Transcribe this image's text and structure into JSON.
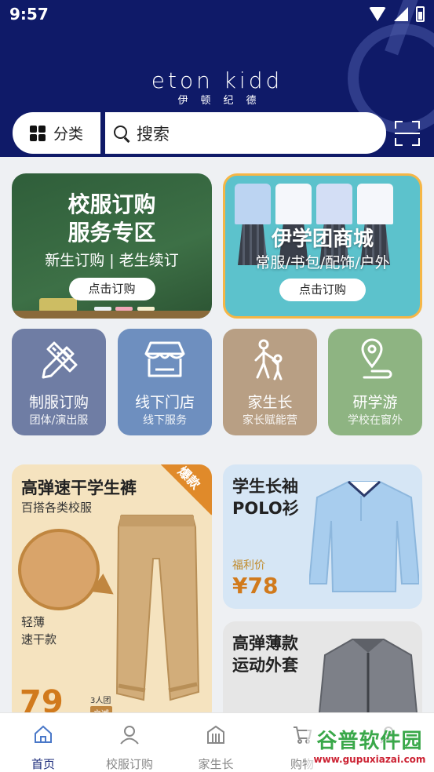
{
  "status": {
    "time": "9:57"
  },
  "brand": {
    "en": "eton kidd",
    "cn": "伊顿纪德"
  },
  "header": {
    "category_label": "分类",
    "search_placeholder": "搜索"
  },
  "banners": [
    {
      "title_line1": "校服订购",
      "title_line2": "服务专区",
      "subtitle": "新生订购 | 老生续订",
      "button": "点击订购"
    },
    {
      "title": "伊学团商城",
      "subtitle": "常服/书包/配饰/户外",
      "button": "点击订购"
    }
  ],
  "tiles": [
    {
      "title": "制服订购",
      "subtitle": "团体/演出服",
      "color": "#6f7da4",
      "icon": "ruler-pencil-icon"
    },
    {
      "title": "线下门店",
      "subtitle": "线下服务",
      "color": "#6e8fbf",
      "icon": "store-icon"
    },
    {
      "title": "家生长",
      "subtitle": "家长赋能营",
      "color": "#b89f84",
      "icon": "family-icon"
    },
    {
      "title": "研学游",
      "subtitle": "学校在窗外",
      "color": "#8eb482",
      "icon": "location-pin-icon"
    }
  ],
  "products": {
    "big": {
      "title": "高弹速干学生裤",
      "subtitle": "百搭各类校服",
      "feature_line1": "轻薄",
      "feature_line2": "速干款",
      "price": "79",
      "badge": "爆款",
      "group_note": "3人团",
      "instant_note": "立减"
    },
    "polo": {
      "title_line1": "学生长袖",
      "title_line2": "POLO衫",
      "sub": "福利价",
      "price": "¥78"
    },
    "jacket": {
      "title_line1": "高弹薄款",
      "title_line2": "运动外套"
    }
  },
  "tabbar": [
    {
      "label": "首页",
      "active": true,
      "icon": "home-icon"
    },
    {
      "label": "校服订购",
      "active": false,
      "icon": "user-icon"
    },
    {
      "label": "家生长",
      "active": false,
      "icon": "building-icon"
    },
    {
      "label": "购物",
      "active": false,
      "icon": "cart-icon"
    },
    {
      "label": "",
      "active": false,
      "icon": "profile-icon"
    }
  ],
  "watermark": {
    "line1": "谷普软件园",
    "line2": "www.gupuxiazai.com"
  },
  "colors": {
    "header_bg": "#0f1a68",
    "accent": "#1a2a7a",
    "price": "#d17a1c"
  }
}
